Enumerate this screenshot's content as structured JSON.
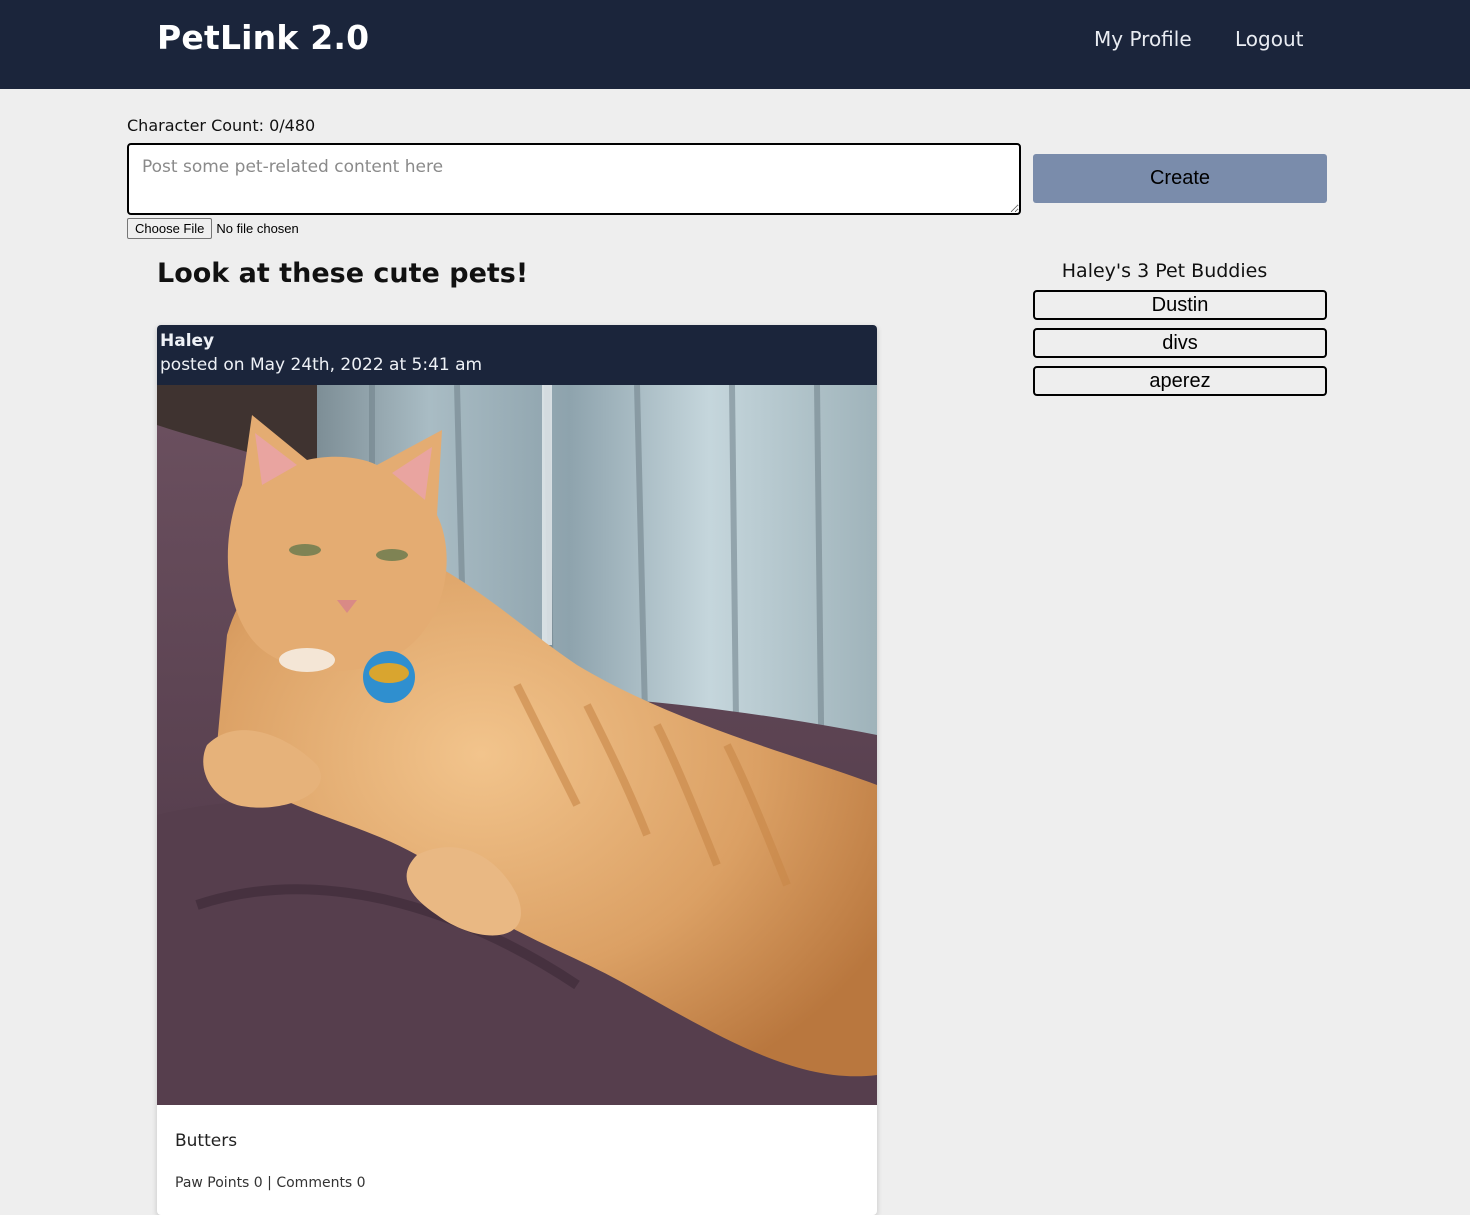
{
  "header": {
    "brand": "PetLink 2.0",
    "nav": {
      "profile_label": "My Profile",
      "logout_label": "Logout"
    }
  },
  "composer": {
    "char_count_label": "Character Count: 0/480",
    "placeholder": "Post some pet-related content here",
    "value": "",
    "file_button_label": "Choose File",
    "file_status": "No file chosen",
    "create_label": "Create"
  },
  "feed": {
    "title": "Look at these cute pets!",
    "posts": [
      {
        "author": "Haley",
        "date": "posted on May 24th, 2022 at 5:41 am",
        "image_description": "orange tabby cat lying on a purple blanket wearing a blue fish-shaped name tag",
        "caption": "Butters",
        "paw_points_label": "Paw Points 0",
        "separator": " | ",
        "comments_label": "Comments 0"
      }
    ]
  },
  "buddies": {
    "title": "Haley's 3 Pet Buddies",
    "list": [
      {
        "name": "Dustin"
      },
      {
        "name": "divs"
      },
      {
        "name": "aperez"
      }
    ]
  },
  "colors": {
    "navbar": "#1b253b",
    "page_background": "#eeeeee",
    "create_button": "#7a8cab"
  }
}
